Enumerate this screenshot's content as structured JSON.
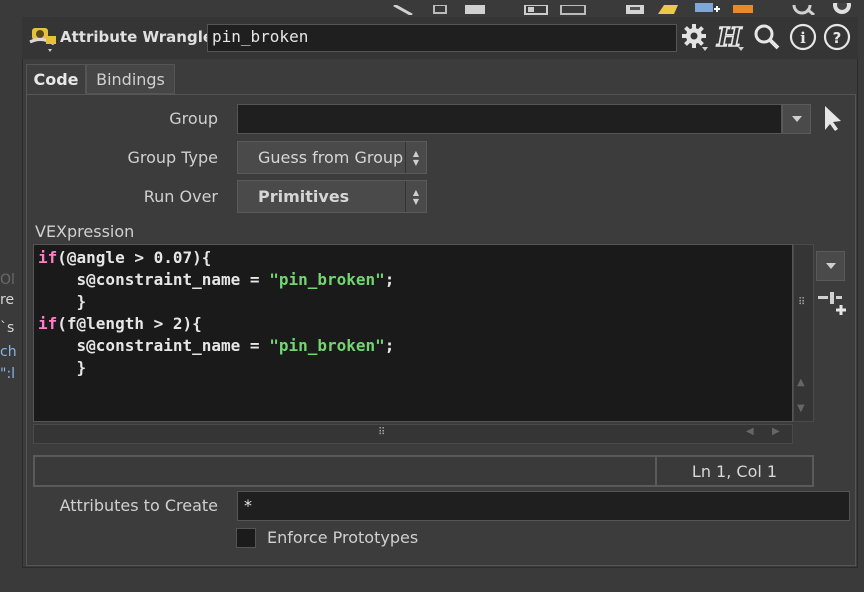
{
  "node": {
    "type_label": "Attribute Wrangle",
    "name": "pin_broken"
  },
  "tabs": [
    {
      "label": "Code"
    },
    {
      "label": "Bindings"
    }
  ],
  "params": {
    "group_label": "Group",
    "group_value": "",
    "group_type_label": "Group Type",
    "group_type_value": "Guess from Group",
    "run_over_label": "Run Over",
    "run_over_value": "Primitives",
    "vexpression_label": "VEXpression",
    "attributes_to_create_label": "Attributes to Create",
    "attributes_to_create_value": "*",
    "enforce_prototypes_label": "Enforce Prototypes"
  },
  "code_lines": [
    [
      {
        "t": "if",
        "k": "kw"
      },
      {
        "t": "(@angle > 0.07){",
        "k": "plain"
      }
    ],
    [
      {
        "t": "    s@constraint_name = ",
        "k": "plain"
      },
      {
        "t": "\"pin_broken\"",
        "k": "str"
      },
      {
        "t": ";",
        "k": "plain"
      }
    ],
    [
      {
        "t": "    }",
        "k": "plain"
      }
    ],
    [
      {
        "t": "if",
        "k": "kw"
      },
      {
        "t": "(f@length > 2){",
        "k": "plain"
      }
    ],
    [
      {
        "t": "    s@constraint_name = ",
        "k": "plain"
      },
      {
        "t": "\"pin_broken\"",
        "k": "str"
      },
      {
        "t": ";",
        "k": "plain"
      }
    ],
    [
      {
        "t": "    }",
        "k": "plain"
      }
    ]
  ],
  "status": {
    "cursor": "Ln 1, Col 1"
  },
  "left_residue": [
    "Ol",
    "re",
    "`s",
    "ch",
    "\":l"
  ],
  "icons": {
    "node": "wrangle-node-icon",
    "gear": "gear-icon",
    "help_h": "houdini-help-icon",
    "search": "search-icon",
    "info": "info-icon",
    "help": "help-icon"
  },
  "colors": {
    "keyword": "#ff7ec9",
    "string": "#72d572",
    "code_bg": "#1a1a1a"
  }
}
